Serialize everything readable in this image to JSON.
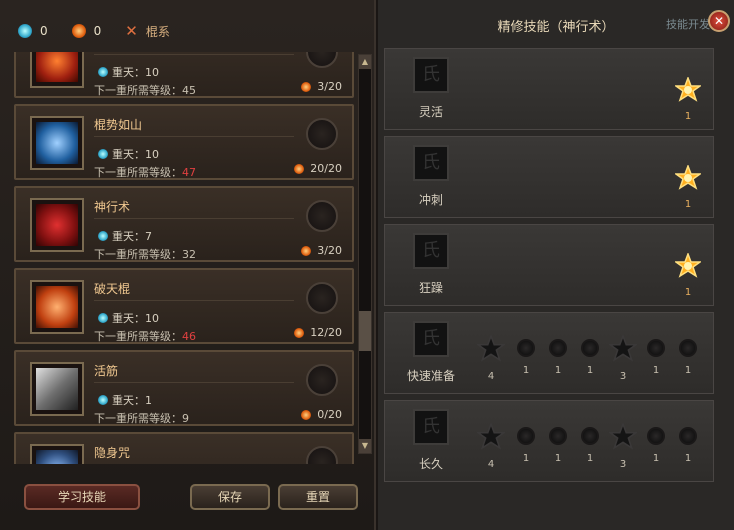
{
  "topbar": {
    "blue_count": "0",
    "orange_count": "0",
    "class_label": "棍系"
  },
  "skills": [
    {
      "name": "",
      "tier": "重天：10",
      "req_label": "下一重所需等级：",
      "req": "45",
      "req_red": false,
      "progress": "3/20",
      "icon": "fire-fist-icon"
    },
    {
      "name": "棍势如山",
      "tier": "重天：10",
      "req_label": "下一重所需等级：",
      "req": "47",
      "req_red": true,
      "progress": "20/20",
      "icon": "spear-strike-icon"
    },
    {
      "name": "神行术",
      "tier": "重天：7",
      "req_label": "下一重所需等级：",
      "req": "32",
      "req_red": false,
      "progress": "3/20",
      "icon": "running-icon"
    },
    {
      "name": "破天棍",
      "tier": "重天：10",
      "req_label": "下一重所需等级：",
      "req": "46",
      "req_red": true,
      "progress": "12/20",
      "icon": "whirlwind-icon"
    },
    {
      "name": "活筋",
      "tier": "重天：1",
      "req_label": "下一重所需等级：",
      "req": "9",
      "req_red": false,
      "progress": "0/20",
      "icon": "muscle-icon"
    },
    {
      "name": "隐身咒",
      "tier": "",
      "req_label": "",
      "req": "",
      "req_red": false,
      "progress": "",
      "icon": "stealth-icon"
    }
  ],
  "buttons": {
    "learn": "学习技能",
    "save": "保存",
    "reset": "重置"
  },
  "panel": {
    "title": "精修技能（神行术）",
    "hint": "技能开发",
    "rows": [
      {
        "name": "灵活",
        "type": "single",
        "value": "1"
      },
      {
        "name": "冲刺",
        "type": "single",
        "value": "1"
      },
      {
        "name": "狂躁",
        "type": "single",
        "value": "1"
      },
      {
        "name": "快速准备",
        "type": "multi",
        "values": [
          "4",
          "1",
          "1",
          "1",
          "3",
          "1",
          "1"
        ]
      },
      {
        "name": "长久",
        "type": "multi",
        "values": [
          "4",
          "1",
          "1",
          "1",
          "3",
          "1",
          "1"
        ]
      }
    ]
  }
}
